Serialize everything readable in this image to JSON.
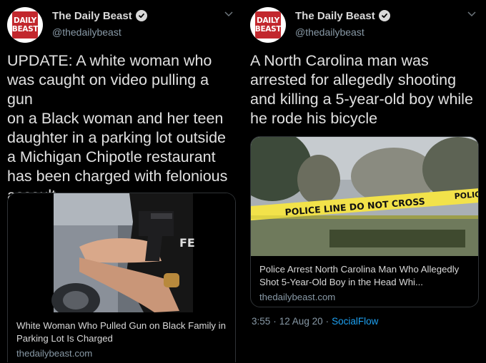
{
  "tweets": [
    {
      "avatar_text": [
        "DAILY",
        "BEAST"
      ],
      "display_name": "The Daily Beast",
      "handle": "@thedailybeast",
      "text": "UPDATE: A white woman who\nwas caught on video pulling a gun\non a Black woman and her teen\ndaughter in a parking lot outside\na Michigan Chipotle restaurant\nhas been charged with felonious\nassault",
      "card": {
        "title": "White Woman Who Pulled Gun on Black Family in Parking Lot Is Charged",
        "domain": "thedailybeast.com"
      }
    },
    {
      "avatar_text": [
        "DAILY",
        "BEAST"
      ],
      "display_name": "The Daily Beast",
      "handle": "@thedailybeast",
      "text": "A North Carolina man was\narrested for allegedly shooting\nand killing a 5-year-old boy while\nhe rode his bicycle",
      "card": {
        "title": "Police Arrest North Carolina Man Who Allegedly Shot 5-Year-Old Boy in the Head Whi...",
        "domain": "thedailybeast.com",
        "tape_text": "POLICE LINE DO NOT CROSS",
        "tape_text_2": "POLIC"
      },
      "meta": {
        "time": "3:55",
        "separator": "·",
        "date": "12 Aug 20",
        "source": "SocialFlow"
      }
    }
  ],
  "colors": {
    "background": "#000000",
    "brand_red": "#c2272d",
    "link_blue": "#1da1f2",
    "secondary_text": "#8899a6",
    "border": "#2f3336",
    "tape_yellow": "#f2e24a"
  }
}
